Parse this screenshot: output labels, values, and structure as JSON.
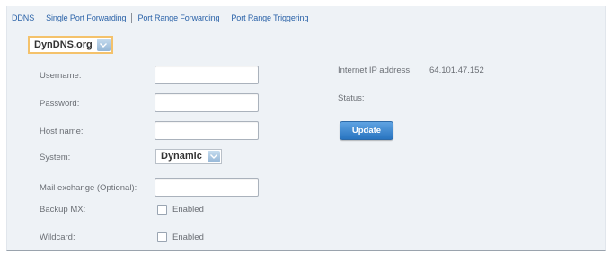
{
  "tabs": [
    {
      "label": "DDNS"
    },
    {
      "label": "Single Port Forwarding"
    },
    {
      "label": "Port Range Forwarding"
    },
    {
      "label": "Port Range Triggering"
    }
  ],
  "provider_select": {
    "value": "DynDNS.org"
  },
  "form": {
    "username_label": "Username:",
    "password_label": "Password:",
    "hostname_label": "Host name:",
    "system_label": "System:",
    "system_value": "Dynamic",
    "mail_label": "Mail exchange (Optional):",
    "backup_label": "Backup MX:",
    "backup_option": "Enabled",
    "wildcard_label": "Wildcard:",
    "wildcard_option": "Enabled"
  },
  "status": {
    "ip_label": "Internet IP address:",
    "ip_value": "64.101.47.152",
    "status_label": "Status:",
    "update_label": "Update"
  },
  "colors": {
    "link": "#2a62a8",
    "button": "#2874c0",
    "highlight_border": "#f4c26b"
  }
}
